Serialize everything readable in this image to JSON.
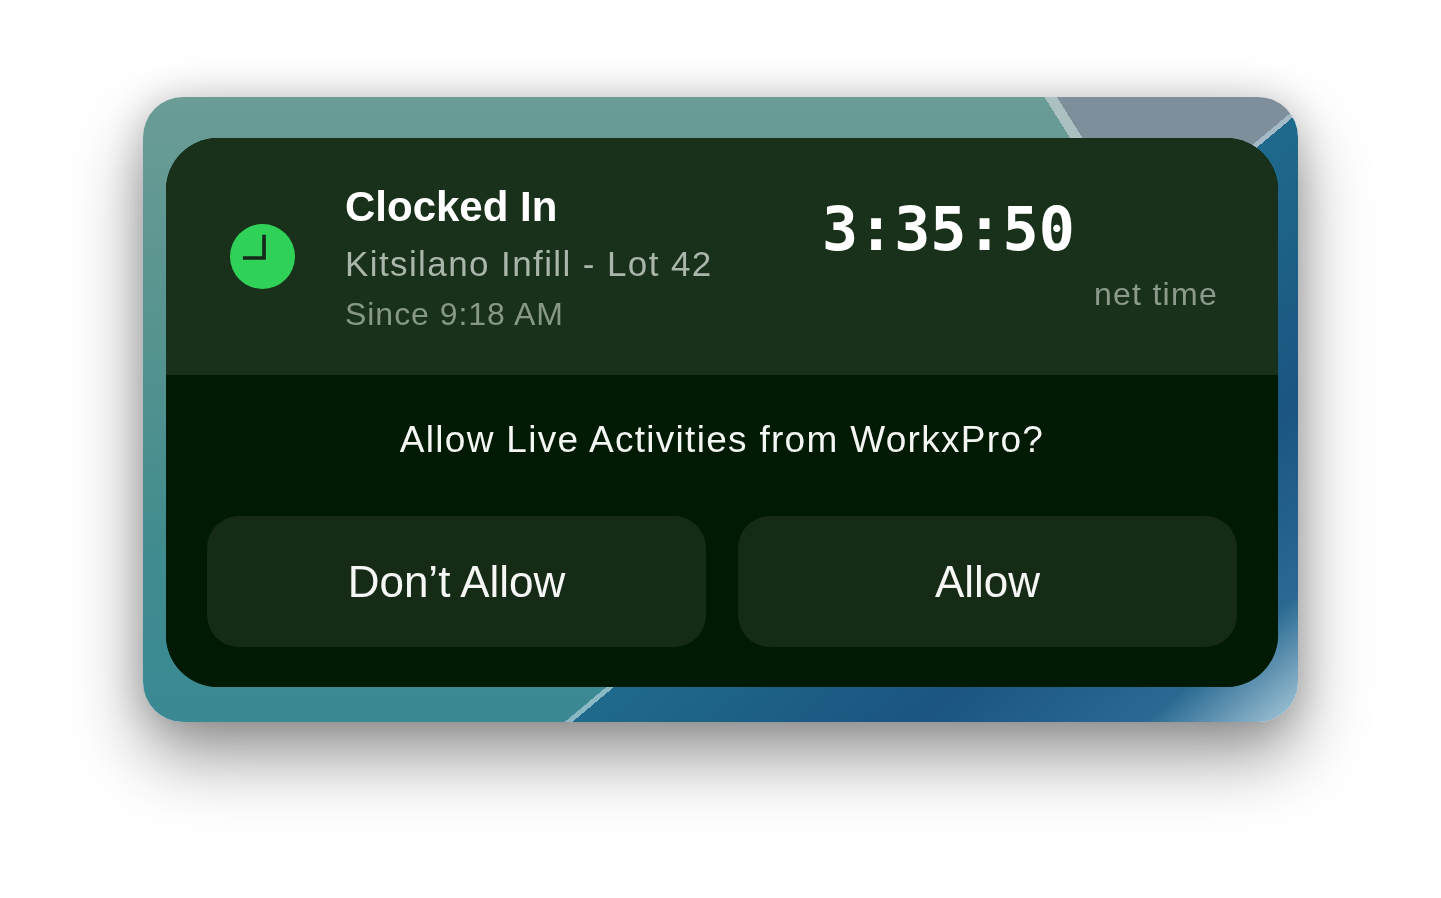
{
  "live_activity": {
    "title": "Clocked In",
    "subtitle": "Kitsilano Infill - Lot 42",
    "detail": "Since 9:18 AM",
    "timer": "3:35:50",
    "timer_label": "net time"
  },
  "permission_prompt": {
    "question": "Allow Live Activities from WorkxPro?",
    "buttons": [
      "Don’t Allow",
      "Allow"
    ]
  }
}
